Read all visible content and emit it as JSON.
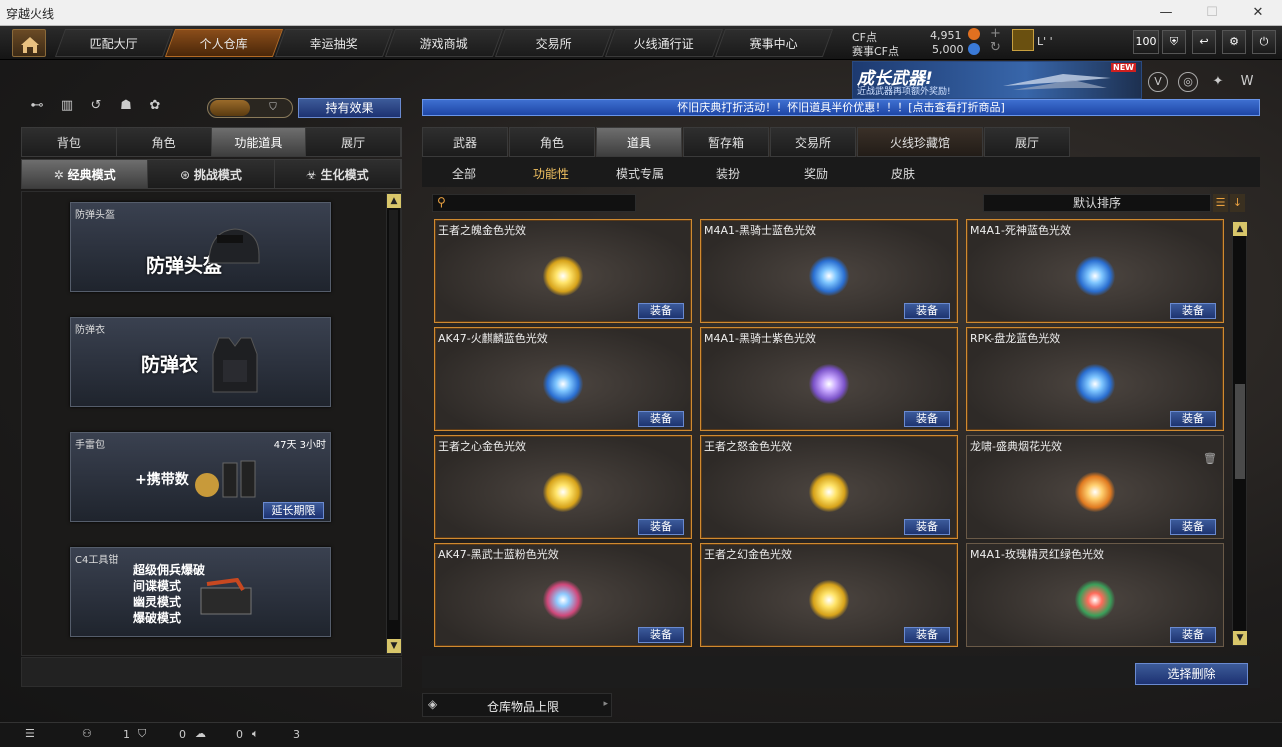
{
  "window": {
    "title": "穿越火线"
  },
  "nav": {
    "tabs": [
      "匹配大厅",
      "个人仓库",
      "幸运抽奖",
      "游戏商城",
      "交易所",
      "火线通行证",
      "赛事中心"
    ],
    "active_tab": 1,
    "cf_label": "CF点",
    "cf_value": "4,951",
    "event_cf_label": "赛事CF点",
    "event_cf_value": "5,000",
    "user_name": "L'  '",
    "level": "100"
  },
  "banner": {
    "title": "成长武器!",
    "subtitle": "近战武器再项额外奖励!",
    "badge": "NEW"
  },
  "left": {
    "effects_button": "持有效果",
    "category_tabs": [
      "背包",
      "角色",
      "功能道具",
      "展厅"
    ],
    "active_category": 2,
    "mode_tabs": [
      "经典模式",
      "挑战模式",
      "生化模式"
    ],
    "cards": [
      {
        "label": "防弹头盔",
        "name": "防弹头盔"
      },
      {
        "label": "防弹衣",
        "name": "防弹衣"
      },
      {
        "label": "手雷包",
        "name": "+携带数",
        "timer": "47天 3小时",
        "extend": "延长期限"
      },
      {
        "label": "C4工具钳",
        "modes": [
          "超级佣兵爆破",
          "间谍模式",
          "幽灵模式",
          "爆破模式"
        ]
      }
    ]
  },
  "right": {
    "notice": "怀旧庆典打折活动！！怀旧道具半价优惠！！！[点击查看打折商品]",
    "tabs": [
      "武器",
      "角色",
      "道具",
      "暂存箱",
      "交易所",
      "火线珍藏馆",
      "展厅"
    ],
    "active_tab": 2,
    "sub_tabs": [
      "全部",
      "功能性",
      "模式专属",
      "装扮",
      "奖励",
      "皮肤"
    ],
    "active_sub_tab": 1,
    "search_placeholder": "",
    "sort_label": "默认排序",
    "equip_label": "装备",
    "items": [
      {
        "name": "王者之魄金色光效",
        "color": "gold"
      },
      {
        "name": "M4A1-黑骑士蓝色光效",
        "color": "blue"
      },
      {
        "name": "M4A1-死神蓝色光效",
        "color": "blue"
      },
      {
        "name": "AK47-火麒麟蓝色光效",
        "color": "blue"
      },
      {
        "name": "M4A1-黑骑士紫色光效",
        "color": "purple"
      },
      {
        "name": "RPK-盘龙蓝色光效",
        "color": "blue"
      },
      {
        "name": "王者之心金色光效",
        "color": "gold"
      },
      {
        "name": "王者之怒金色光效",
        "color": "gold"
      },
      {
        "name": "龙啸-盛典烟花光效",
        "color": "orange"
      },
      {
        "name": "AK47-黑武士蓝粉色光效",
        "color": "pinkblue"
      },
      {
        "name": "王者之幻金色光效",
        "color": "gold"
      },
      {
        "name": "M4A1-玫瑰精灵红绿色光效",
        "color": "redgreen"
      }
    ],
    "select_delete": "选择删除",
    "storage_limit": "仓库物品上限"
  },
  "status": {
    "count1": "1",
    "count2": "0",
    "count3": "0",
    "count4": "3"
  }
}
